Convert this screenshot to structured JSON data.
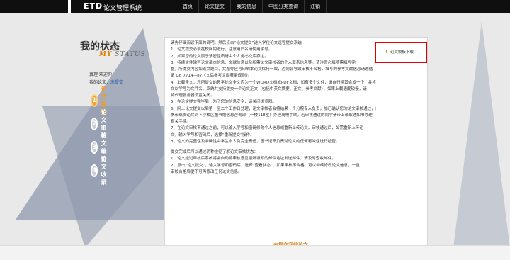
{
  "brand": {
    "logo": "ETD",
    "system_name": "论文管理系统"
  },
  "nav": {
    "items": [
      "首页",
      "论文提交",
      "我的信息",
      "中图分类查询",
      "注销"
    ]
  },
  "status": {
    "title": "我的状态",
    "subtitle_my": "MY",
    "subtitle_rest": "STATUS",
    "greeting": "真理  欢迎你",
    "thesis_label": "我的论文：",
    "thesis_value": "未提交"
  },
  "steps": [
    {
      "num": "1",
      "label": "论文提交",
      "active": true
    },
    {
      "num": "2",
      "label": "论文审核",
      "active": false
    },
    {
      "num": "3",
      "label": "论文编目",
      "active": false
    },
    {
      "num": "4",
      "label": "论文收录",
      "active": false
    }
  ],
  "download_label": "论文模板下载",
  "instructions": [
    "请先仔细阅读下面的说明，然后点击“论文提交”进入学位论文远程提交系统",
    "1、论文提交必须在校网内进行，注意用户名请使用学号。",
    "2、如果您的论文属于涉密性质请由个人务必交库存这。",
    "3、持续文件输写论文基本信息、文献信息以及所需论文审核者的个人联系信息等。请注意必填项需填写完",
    "整，所提交内容如论文题目、文题等应与印刷本论文保持一致，否则会导致审核不合格，填写的参考文献信息请遵循",
    "循 GB 7714—87《文后参考文献著录规则》。",
    "4、上载全文，您所提交的教学论文全文应为一个WORD文档或PDF文档，如有多个文件，请自行将其合成一个，并将全",
    "文以学号为文件名。系统共支持提交一个论文正文（包括中英文摘要、正文、参考文献），如果上载速度较慢，请",
    "将代理服务器设置关闭。",
    "5、在论文提交完毕后，为了您的信息安全，请关闭浏览器。",
    "6、网上论文提交以后第一至二个工作日处理，论文审核者会将结果一个分院专人负责，加已确认您的论文审核通过，便可",
    "携带纸质论文到下沙校区图书馆信息咨询部（一楼118室）办理离校手续。若审核通过的同学请带上录取通知书办理",
    "有关手续。",
    "7、在论文审核不通过之前，可以输入学号和密码修改个人信息或重新上传论文。审核通过后，如需重新上传论",
    "文，输入学号和密码后，选择“重新提交”操作。",
    "8、论文的完整性及准确性由学生本人负完全责任，图书馆不负责对论文的任何有效性进行检查。"
  ],
  "instructions2": [
    "提交完成后可以通过两种途径了解论文审核状态：",
    "1、论文经过审核后系统将会自动将审核意见按所填写的邮件地址发送邮件，请及时查收邮件。",
    "2、点击“论文提交”，输入学号和密码后，选择“查看状态”。如果审核不合格，可以继续修改论文信息，一旦",
    "审核合格后便不可再修改任何论文信息。"
  ],
  "submit_link": "去提交我的论文"
}
